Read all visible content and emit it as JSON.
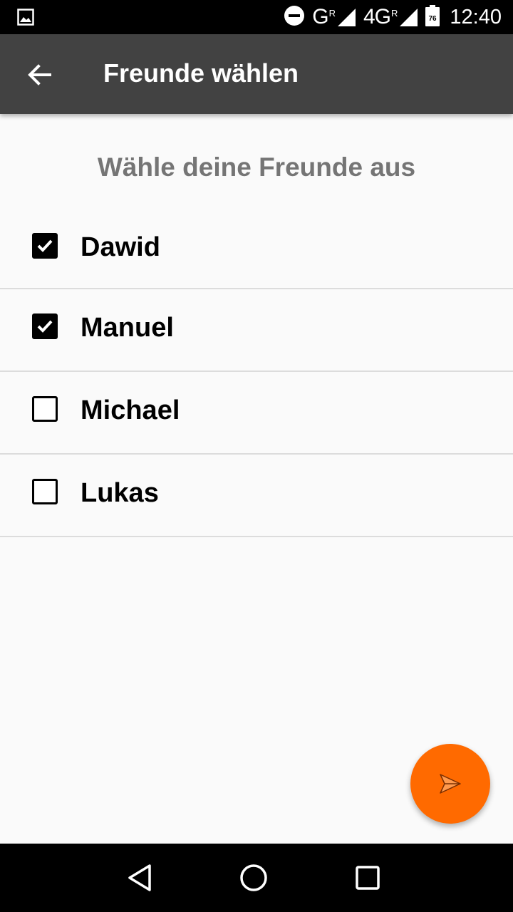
{
  "status_bar": {
    "network_1": "G",
    "network_1_roaming": "R",
    "network_2": "4G",
    "network_2_roaming": "R",
    "battery_level": "76",
    "time": "12:40"
  },
  "app_bar": {
    "title": "Freunde wählen",
    "back_icon": "arrow-back-icon"
  },
  "subtitle": "Wähle deine Freunde aus",
  "friends": [
    {
      "name": "Dawid",
      "checked": true
    },
    {
      "name": "Manuel",
      "checked": true
    },
    {
      "name": "Michael",
      "checked": false
    },
    {
      "name": "Lukas",
      "checked": false
    }
  ],
  "fab": {
    "icon": "send-icon",
    "color": "#ff6a00"
  },
  "colors": {
    "app_bar": "#424242",
    "accent": "#ff6a00",
    "subtitle_text": "#757575",
    "background": "#fafafa"
  },
  "nav_bar": {
    "back_icon": "nav-back-icon",
    "home_icon": "nav-home-icon",
    "recents_icon": "nav-recents-icon"
  }
}
